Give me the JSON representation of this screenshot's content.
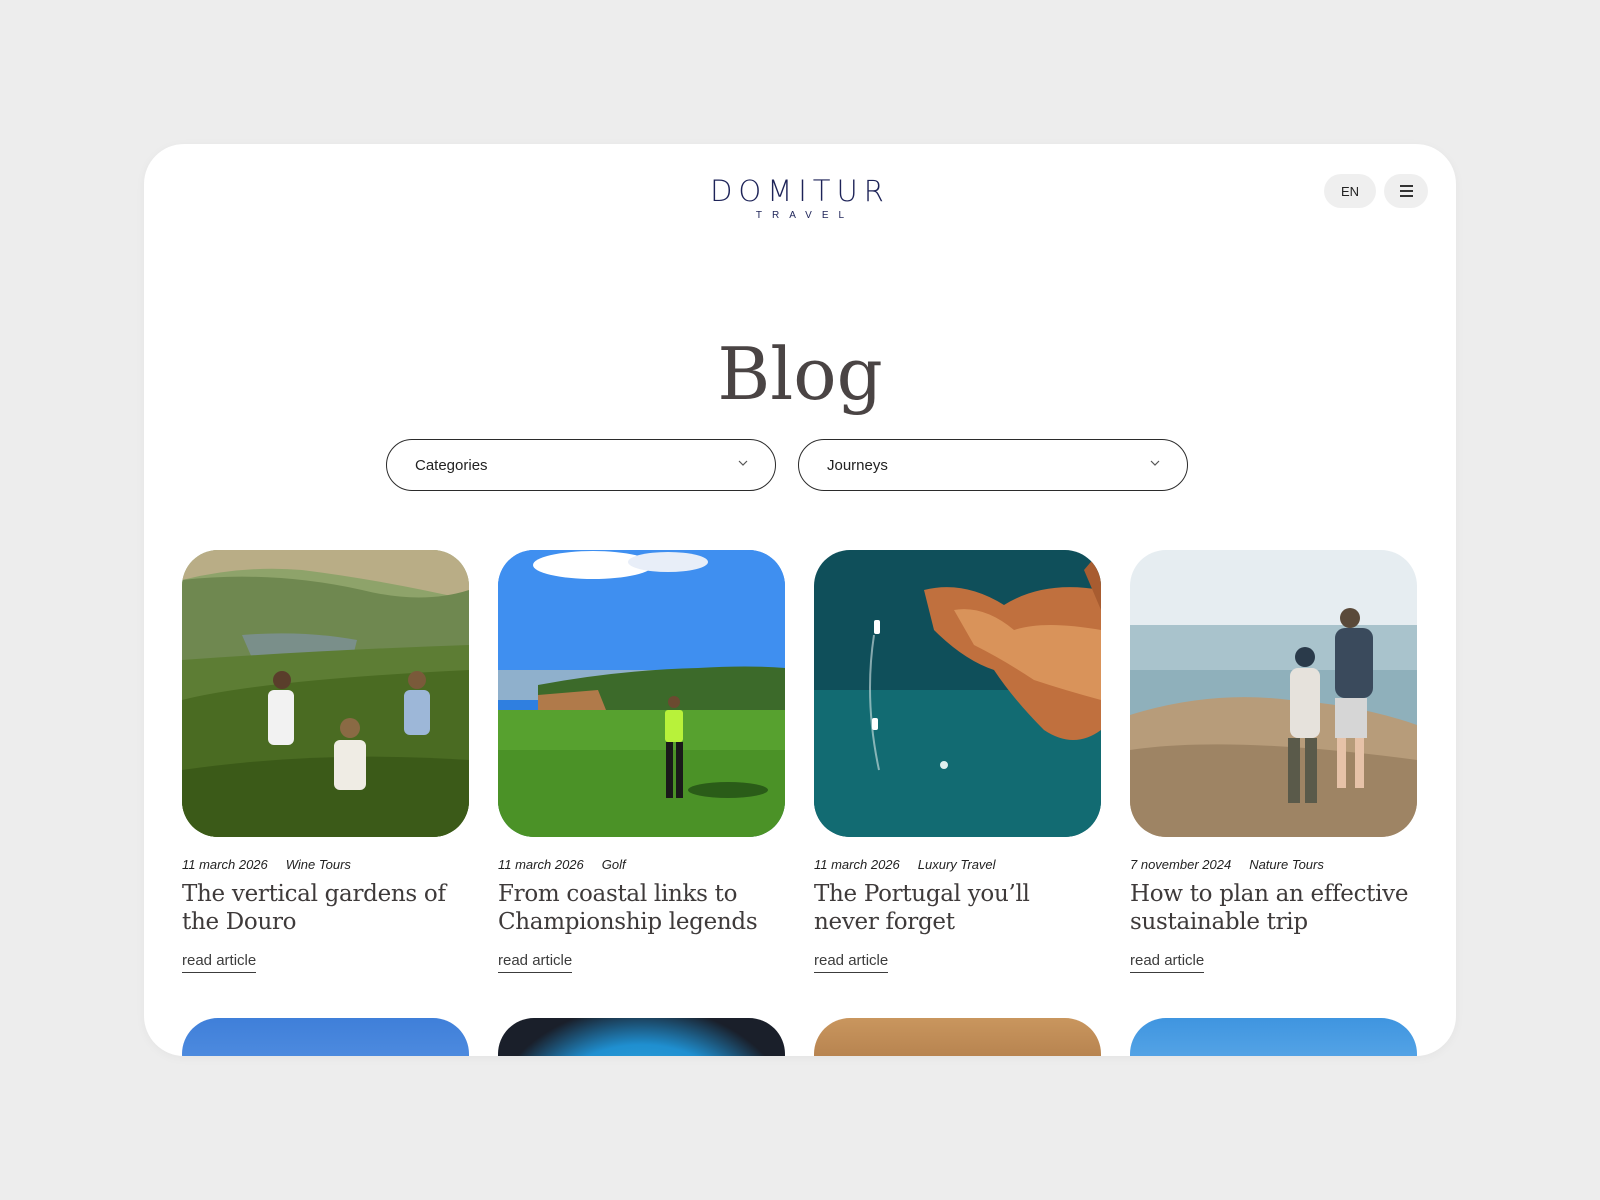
{
  "header": {
    "logo_main": "DOMITUR",
    "logo_sub": "TRAVEL",
    "lang": "EN"
  },
  "page": {
    "title": "Blog"
  },
  "filters": {
    "categories": "Categories",
    "journeys": "Journeys"
  },
  "posts": [
    {
      "date": "11 march 2026",
      "category": "Wine Tours",
      "title": "The vertical gardens of the Douro",
      "link": "read article"
    },
    {
      "date": "11 march 2026",
      "category": "Golf",
      "title": "From coastal links to Championship legends",
      "link": "read article"
    },
    {
      "date": "11 march 2026",
      "category": "Luxury Travel",
      "title": "The Portugal you’ll never forget",
      "link": "read article"
    },
    {
      "date": "7 november 2024",
      "category": "Nature Tours",
      "title": "How to plan an effective sustainable trip",
      "link": "read article"
    }
  ],
  "icons": {
    "menu": "menu-icon",
    "chevron": "chevron-down-icon"
  },
  "colors": {
    "brand": "#1d2358",
    "background": "#ededed",
    "card": "#ffffff",
    "text": "#3e3a3a"
  }
}
